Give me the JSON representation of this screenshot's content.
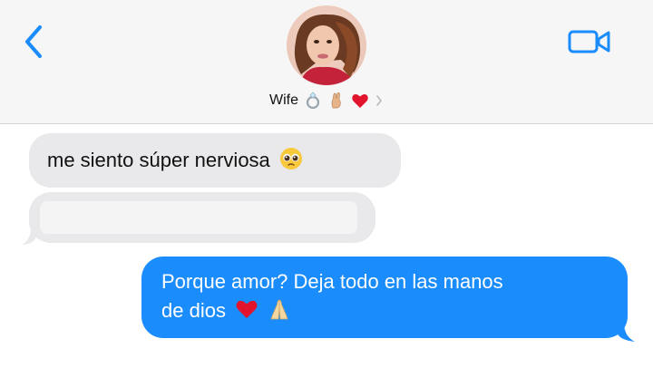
{
  "header": {
    "contact_name": "Wife",
    "status_icons": [
      "ring-icon",
      "crossed-fingers-icon",
      "red-heart-icon"
    ],
    "back_icon": "chevron-left-icon",
    "video_icon": "video-camera-icon",
    "accent_color": "#1a8cfb"
  },
  "messages": [
    {
      "direction": "incoming",
      "text": "me siento súper nerviosa",
      "emoji": "pleading-face-icon"
    },
    {
      "direction": "incoming",
      "text": "",
      "redacted": true
    },
    {
      "direction": "outgoing",
      "line1": "Porque amor? Deja todo en las manos",
      "line2": "de dios",
      "emojis": [
        "red-heart-icon",
        "folded-hands-icon"
      ]
    }
  ],
  "colors": {
    "incoming_bubble": "#e9e9eb",
    "outgoing_bubble": "#1a8cfb",
    "header_bg": "#f6f6f7"
  }
}
